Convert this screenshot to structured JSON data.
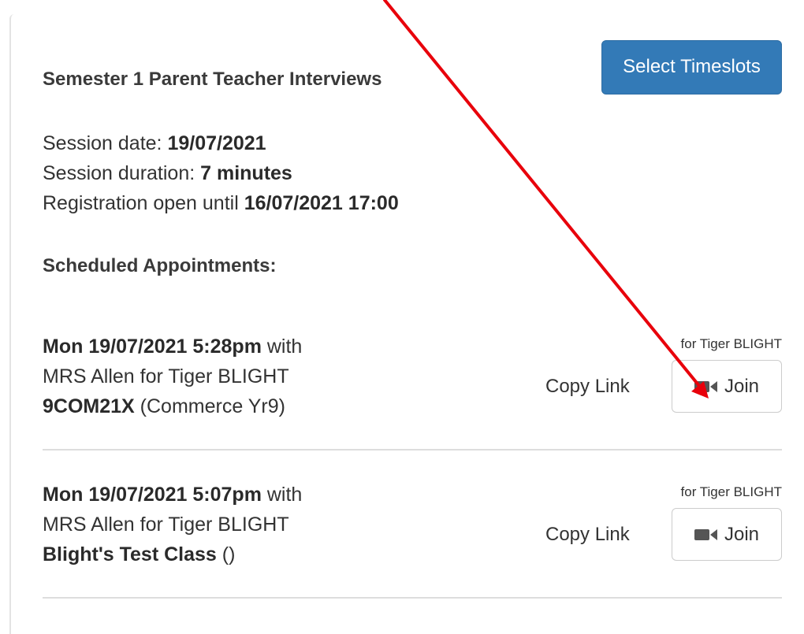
{
  "header": {
    "title": "Semester 1 Parent Teacher Interviews",
    "select_timeslots_label": "Select Timeslots"
  },
  "session": {
    "date_label": "Session date: ",
    "date_value": "19/07/2021",
    "duration_label": "Session duration: ",
    "duration_value": "7 minutes",
    "registration_label": "Registration open until ",
    "registration_value": "16/07/2021 17:00"
  },
  "scheduled_heading": "Scheduled Appointments:",
  "appointments": [
    {
      "datetime": "Mon 19/07/2021 5:28pm",
      "with_label": " with",
      "teacher_line": "MRS Allen for Tiger BLIGHT",
      "class_code": "9COM21X",
      "class_name": " (Commerce Yr9)",
      "for_student": "for Tiger BLIGHT",
      "copy_link_label": "Copy Link",
      "join_label": "Join",
      "join_icon": "video-camera-icon"
    },
    {
      "datetime": "Mon 19/07/2021 5:07pm",
      "with_label": " with",
      "teacher_line": "MRS Allen for Tiger BLIGHT",
      "class_code": "Blight's Test Class",
      "class_name": " ()",
      "for_student": "for Tiger BLIGHT",
      "copy_link_label": "Copy Link",
      "join_label": "Join",
      "join_icon": "video-camera-icon"
    }
  ],
  "colors": {
    "primary_button": "#337ab7",
    "annotation_arrow": "#e8000b",
    "divider": "#dddddd"
  }
}
